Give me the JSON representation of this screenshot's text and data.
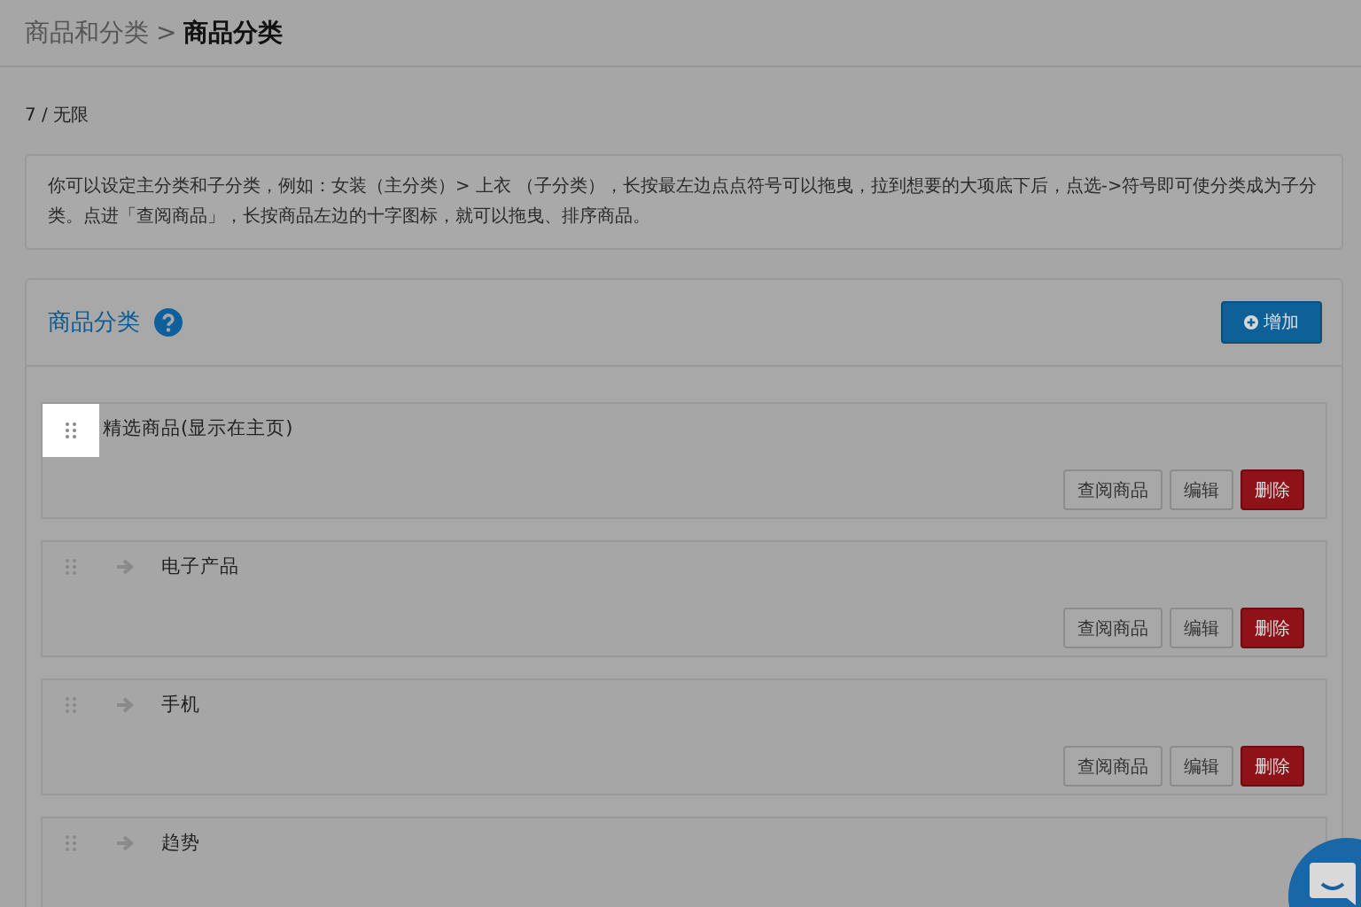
{
  "breadcrumb": {
    "parent": "商品和分类",
    "separator": ">",
    "current": "商品分类"
  },
  "count": "7 / 无限",
  "notice": "你可以设定主分类和子分类，例如：女装（主分类）> 上衣 （子分类），长按最左边点点符号可以拖曳，拉到想要的大项底下后，点选->符号即可使分类成为子分类。点进「查阅商品」，长按商品左边的十字图标，就可以拖曳、排序商品。",
  "panel": {
    "title": "商品分类",
    "add_button": "增加",
    "categories": [
      {
        "kind": "main",
        "name": "精选商品(显示在主页)",
        "highlighted": true,
        "buttons": [
          "查阅商品",
          "编辑",
          "删除"
        ]
      },
      {
        "kind": "sub",
        "name": "电子产品",
        "highlighted": false,
        "buttons": [
          "查阅商品",
          "编辑",
          "删除"
        ]
      },
      {
        "kind": "sub",
        "name": "手机",
        "highlighted": false,
        "buttons": [
          "查阅商品",
          "编辑",
          "删除"
        ]
      },
      {
        "kind": "sub",
        "name": "趋势",
        "highlighted": false
      }
    ]
  }
}
